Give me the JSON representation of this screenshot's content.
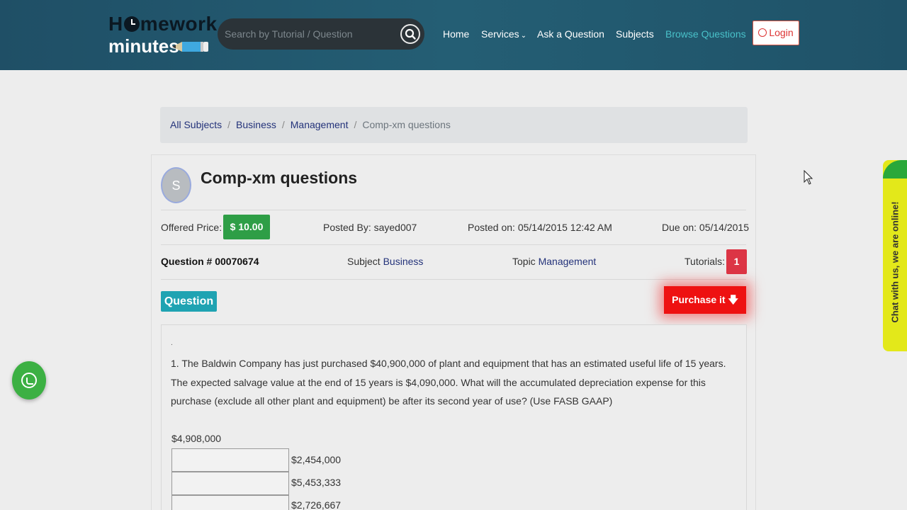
{
  "header": {
    "logo_line1_a": "H",
    "logo_line1_b": "mework",
    "logo_line2": "minutes",
    "search_placeholder": "Search by Tutorial / Question",
    "nav": {
      "home": "Home",
      "services": "Services",
      "ask": "Ask a Question",
      "subjects": "Subjects",
      "browse": "Browse Questions"
    },
    "login": "Login"
  },
  "breadcrumb": {
    "items": [
      "All Subjects",
      "Business",
      "Management"
    ],
    "separator": "/",
    "current": "Comp-xm questions"
  },
  "question": {
    "avatar_letter": "S",
    "title": "Comp-xm questions",
    "offered_price_label": "Offered Price:",
    "offered_price": "$ 10.00",
    "posted_by": "Posted By: sayed007",
    "posted_on": "Posted on: 05/14/2015 12:42 AM",
    "due_on": "Due on: 05/14/2015",
    "number": "Question # 00070674",
    "subject_label": "Subject",
    "subject": "Business",
    "topic_label": "Topic",
    "topic": "Management",
    "tutorials_label": "Tutorials:",
    "tutorials_count": "1",
    "question_tab": "Question",
    "purchase_label": "Purchase it",
    "body_dot": ".",
    "body": "1. The Baldwin Company has just purchased $40,900,000 of plant and equipment that has an estimated useful life of 15 years. The expected salvage value at the end of 15 years is $4,090,000. What will the accumulated depreciation expense for this purchase (exclude all other plant and equipment) be after its second year of use? (Use FASB GAAP)",
    "option0": "$4,908,000",
    "options": [
      "$2,454,000",
      "$5,453,333",
      "$2,726,667"
    ]
  },
  "chat": {
    "label": "Chat with us, we are online!"
  },
  "colors": {
    "header_bg": "#245e74",
    "price_green": "#2e9e46",
    "purchase_red": "#ee1111",
    "question_teal": "#1fa3b2",
    "link_navy": "#23327a",
    "chat_yellow": "#e3e81a"
  }
}
